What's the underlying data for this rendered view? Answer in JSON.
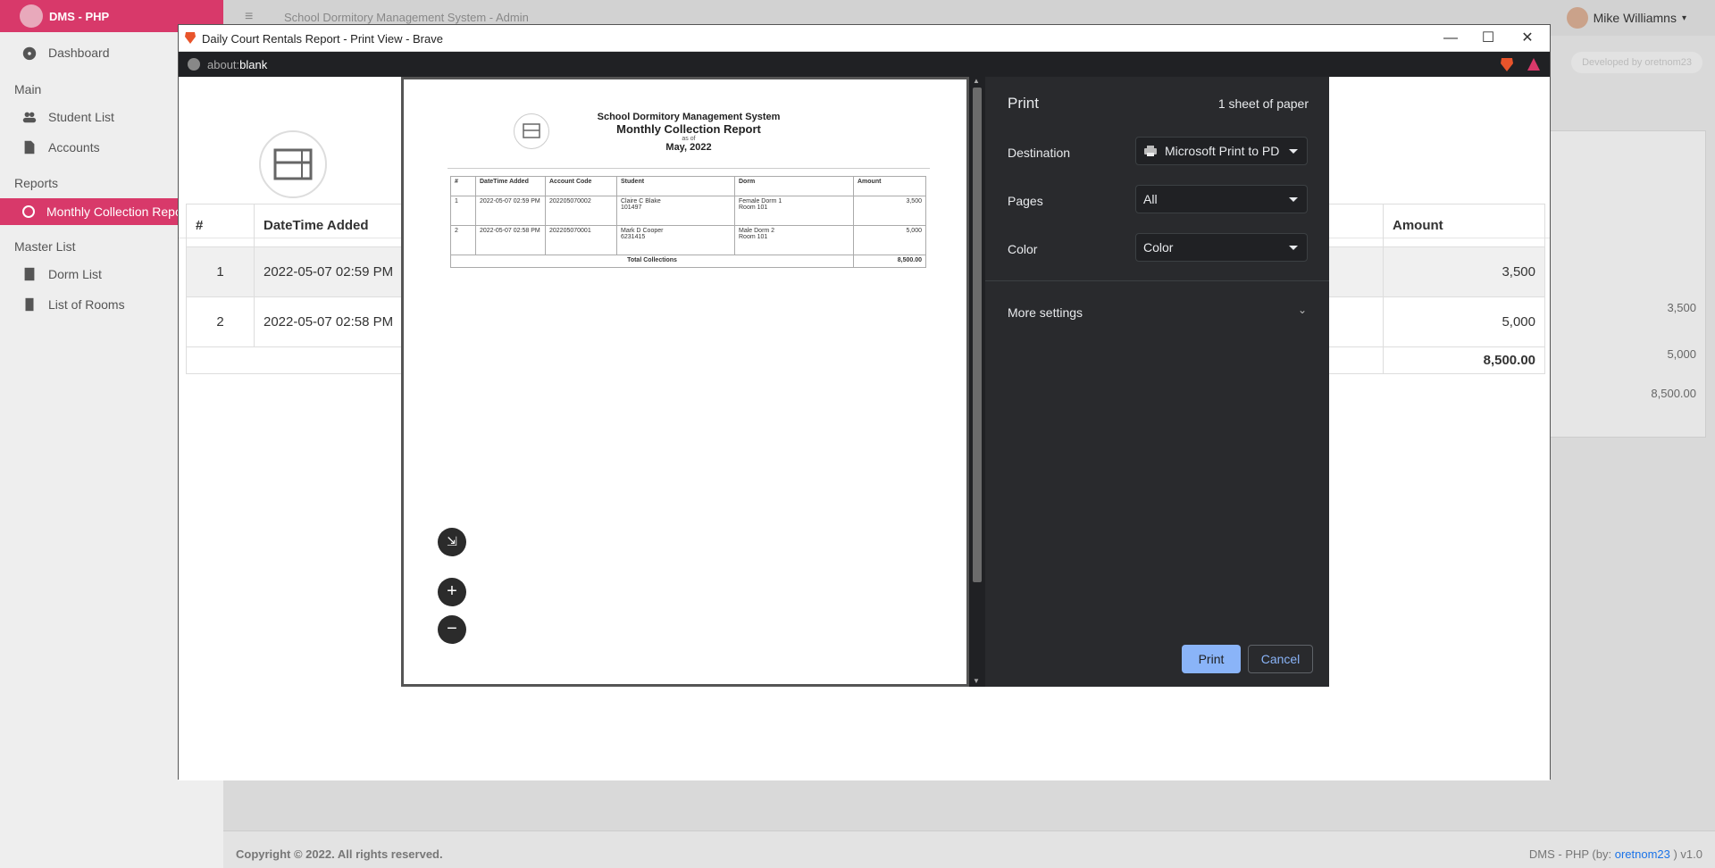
{
  "app": {
    "brand": "DMS - PHP",
    "header_title": "School Dormitory Management System - Admin",
    "user_name": "Mike Williamns",
    "developed_by": "Developed by oretnom23"
  },
  "sidebar": {
    "dashboard": "Dashboard",
    "main_head": "Main",
    "student_list": "Student List",
    "accounts": "Accounts",
    "reports_head": "Reports",
    "monthly_report": "Monthly Collection Report",
    "master_head": "Master List",
    "dorm_list": "Dorm List",
    "list_rooms": "List of Rooms"
  },
  "bg_values": {
    "v1": "3,500",
    "v2": "5,000",
    "total": "8,500.00"
  },
  "footer": {
    "copyright": "Copyright © 2022. All rights reserved.",
    "version_prefix": "DMS - PHP (by: ",
    "author": "oretnom23",
    "version_suffix": " ) v1.0"
  },
  "popup": {
    "title": "Daily Court Rentals Report - Print View - Brave",
    "url_prefix": "about:",
    "url_main": "blank",
    "page_table": {
      "headers": {
        "num": "#",
        "datetime": "DateTime Added",
        "amount": "Amount"
      },
      "rows": [
        {
          "num": "1",
          "datetime": "2022-05-07 02:59 PM",
          "amount": "3,500"
        },
        {
          "num": "2",
          "datetime": "2022-05-07 02:58 PM",
          "amount": "5,000"
        }
      ],
      "total": "8,500.00"
    }
  },
  "report": {
    "org": "School Dormitory Management System",
    "title": "Monthly Collection Report",
    "as_of": "as of",
    "period": "May, 2022",
    "headers": [
      "#",
      "DateTime Added",
      "Account Code",
      "Student",
      "Dorm",
      "Amount"
    ],
    "rows": [
      {
        "num": "1",
        "datetime": "2022-05-07 02:59 PM",
        "code": "202205070002",
        "student": "Claire C Blake",
        "student_id": "101497",
        "dorm": "Female Dorm 1",
        "room": "Room 101",
        "amount": "3,500"
      },
      {
        "num": "2",
        "datetime": "2022-05-07 02:58 PM",
        "code": "202205070001",
        "student": "Mark D Cooper",
        "student_id": "6231415",
        "dorm": "Male Dorm 2",
        "room": "Room 101",
        "amount": "5,000"
      }
    ],
    "total_label": "Total Collections",
    "total": "8,500.00"
  },
  "print": {
    "title": "Print",
    "sheets": "1 sheet of paper",
    "destination_label": "Destination",
    "destination_value": "Microsoft Print to PDF",
    "pages_label": "Pages",
    "pages_value": "All",
    "color_label": "Color",
    "color_value": "Color",
    "more_settings": "More settings",
    "print_button": "Print",
    "cancel_button": "Cancel"
  },
  "zoom": {
    "fit": "⇲",
    "plus": "+",
    "minus": "−"
  },
  "colors": {
    "brand": "#d8396a",
    "panel": "#292a2d",
    "print_button": "#8ab4f8"
  }
}
